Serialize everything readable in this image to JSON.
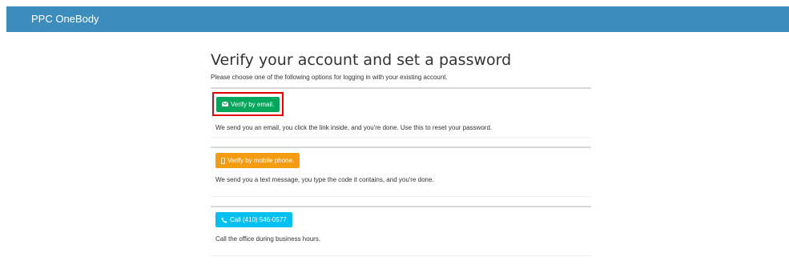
{
  "header": {
    "brand": "PPC OneBody"
  },
  "main": {
    "title": "Verify your account and set a password",
    "subtitle": "Please choose one of the following options for logging in with your existing account.",
    "options": [
      {
        "button_label": "Verify by email.",
        "icon": "envelope-icon",
        "color": "#00a65a",
        "description": "We send you an email, you click the link inside, and you're done. Use this to reset your password."
      },
      {
        "button_label": "Verify by mobile phone.",
        "icon": "mobile-phone-icon",
        "color": "#f39c12",
        "description": "We send you a text message, you type the code it contains, and you're done."
      },
      {
        "button_label": "Call (410) 546-0577",
        "icon": "phone-icon",
        "color": "#00c0ef",
        "description": "Call the office during business hours."
      }
    ]
  },
  "colors": {
    "topbar": "#3c8dbc",
    "highlight_border": "#e00000"
  }
}
